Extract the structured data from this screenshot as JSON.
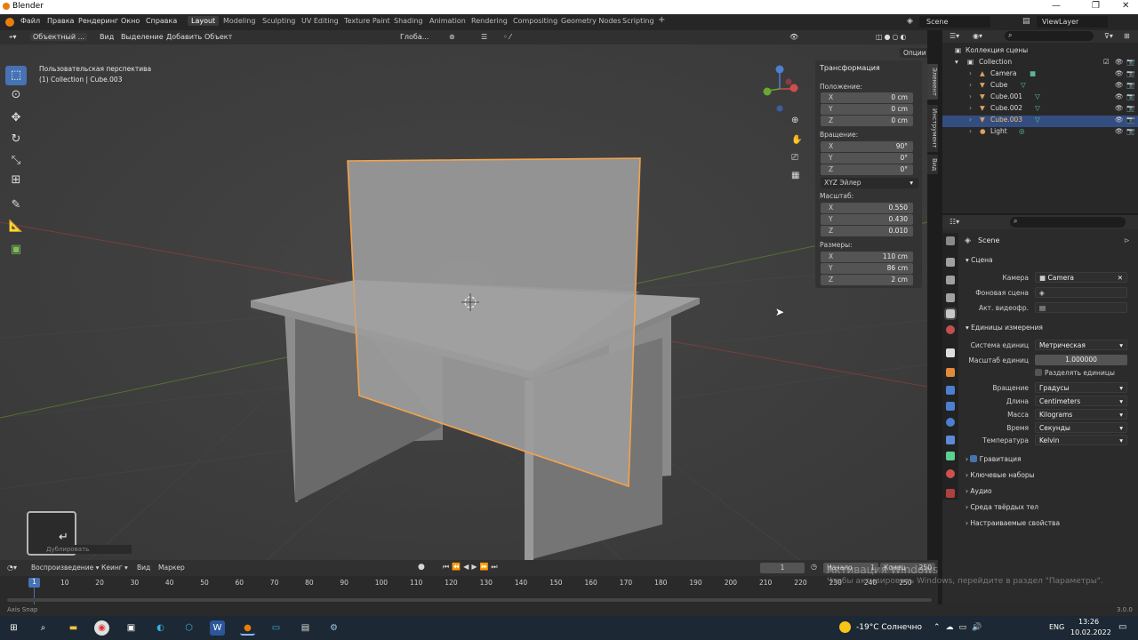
{
  "titlebar": {
    "title": "Blender",
    "min": "—",
    "max": "❐",
    "close": "✕"
  },
  "menu": {
    "items": [
      "Файл",
      "Правка",
      "Рендеринг",
      "Окно",
      "Справка"
    ]
  },
  "workspaces": [
    "Layout",
    "Modeling",
    "Sculpting",
    "UV Editing",
    "Texture Paint",
    "Shading",
    "Animation",
    "Rendering",
    "Compositing",
    "Geometry Nodes",
    "Scripting"
  ],
  "top_right": {
    "scene": "Scene",
    "viewlayer": "ViewLayer"
  },
  "viewport_header": {
    "mode": "Объектный ...",
    "view": "Вид",
    "select": "Выделение",
    "add": "Добавить",
    "object": "Объект",
    "orient": "Глоба...",
    "options": "Опции"
  },
  "viewport": {
    "perspective": "Пользовательская перспектива",
    "collection": "(1) Collection | Cube.003",
    "op_panel": "Дублировать"
  },
  "npanel": {
    "title": "Трансформация",
    "location_label": "Положение:",
    "location": [
      {
        "axis": "X",
        "value": "0 cm"
      },
      {
        "axis": "Y",
        "value": "0 cm"
      },
      {
        "axis": "Z",
        "value": "0 cm"
      }
    ],
    "rotation_label": "Вращение:",
    "rotation": [
      {
        "axis": "X",
        "value": "90°"
      },
      {
        "axis": "Y",
        "value": "0°"
      },
      {
        "axis": "Z",
        "value": "0°"
      }
    ],
    "rotation_mode": "XYZ Эйлер",
    "scale_label": "Масштаб:",
    "scale": [
      {
        "axis": "X",
        "value": "0.550"
      },
      {
        "axis": "Y",
        "value": "0.430"
      },
      {
        "axis": "Z",
        "value": "0.010"
      }
    ],
    "dims_label": "Размеры:",
    "dims": [
      {
        "axis": "X",
        "value": "110 cm"
      },
      {
        "axis": "Y",
        "value": "86 cm"
      },
      {
        "axis": "Z",
        "value": "2 cm"
      }
    ]
  },
  "sidetabs": [
    "Элемент",
    "Инструмент",
    "Вид"
  ],
  "outliner": {
    "root": "Коллекция сцены",
    "items": [
      {
        "name": "Collection",
        "indent": 0
      },
      {
        "name": "Camera",
        "indent": 1
      },
      {
        "name": "Cube",
        "indent": 1
      },
      {
        "name": "Cube.001",
        "indent": 1
      },
      {
        "name": "Cube.002",
        "indent": 1
      },
      {
        "name": "Cube.003",
        "indent": 1,
        "selected": true
      },
      {
        "name": "Light",
        "indent": 1
      }
    ]
  },
  "props": {
    "scene_name": "Scene",
    "scene_section": "Сцена",
    "camera_label": "Камера",
    "camera_value": "Camera",
    "bg_label": "Фоновая сцена",
    "clip_label": "Акт. видеофр.",
    "units_section": "Единицы измерения",
    "unit_system_label": "Система единиц",
    "unit_system": "Метрическая",
    "unit_scale_label": "Масштаб единиц",
    "unit_scale": "1.000000",
    "separate_units": "Разделять единицы",
    "rotation_label": "Вращение",
    "rotation": "Градусы",
    "length_label": "Длина",
    "length": "Centimeters",
    "mass_label": "Масса",
    "mass": "Kilograms",
    "time_label": "Время",
    "time": "Секунды",
    "temp_label": "Температура",
    "temp": "Kelvin",
    "sections": [
      "Гравитация",
      "Ключевые наборы",
      "Аудио",
      "Среда твёрдых тел",
      "Настраиваемые свойства"
    ]
  },
  "timeline": {
    "playback": "Воспроизведение",
    "keying": "Кеинг",
    "view": "Вид",
    "marker": "Маркер",
    "current": "1",
    "start_label": "Начало",
    "start": "1",
    "end_label": "Конец",
    "end": "250",
    "ticks": [
      "10",
      "20",
      "30",
      "40",
      "50",
      "60",
      "70",
      "80",
      "90",
      "100",
      "110",
      "120",
      "130",
      "140",
      "150",
      "160",
      "170",
      "180",
      "190",
      "200",
      "210",
      "220",
      "230",
      "240",
      "250"
    ]
  },
  "status": {
    "left": "Axis Snap",
    "version": "3.0.0"
  },
  "watermark": {
    "line1": "Активация Windows",
    "line2": "Чтобы активировать Windows, перейдите в раздел \"Параметры\"."
  },
  "taskbar": {
    "weather": "-19°C Солнечно",
    "lang": "ENG",
    "time": "13:26",
    "date": "10.02.2022"
  }
}
